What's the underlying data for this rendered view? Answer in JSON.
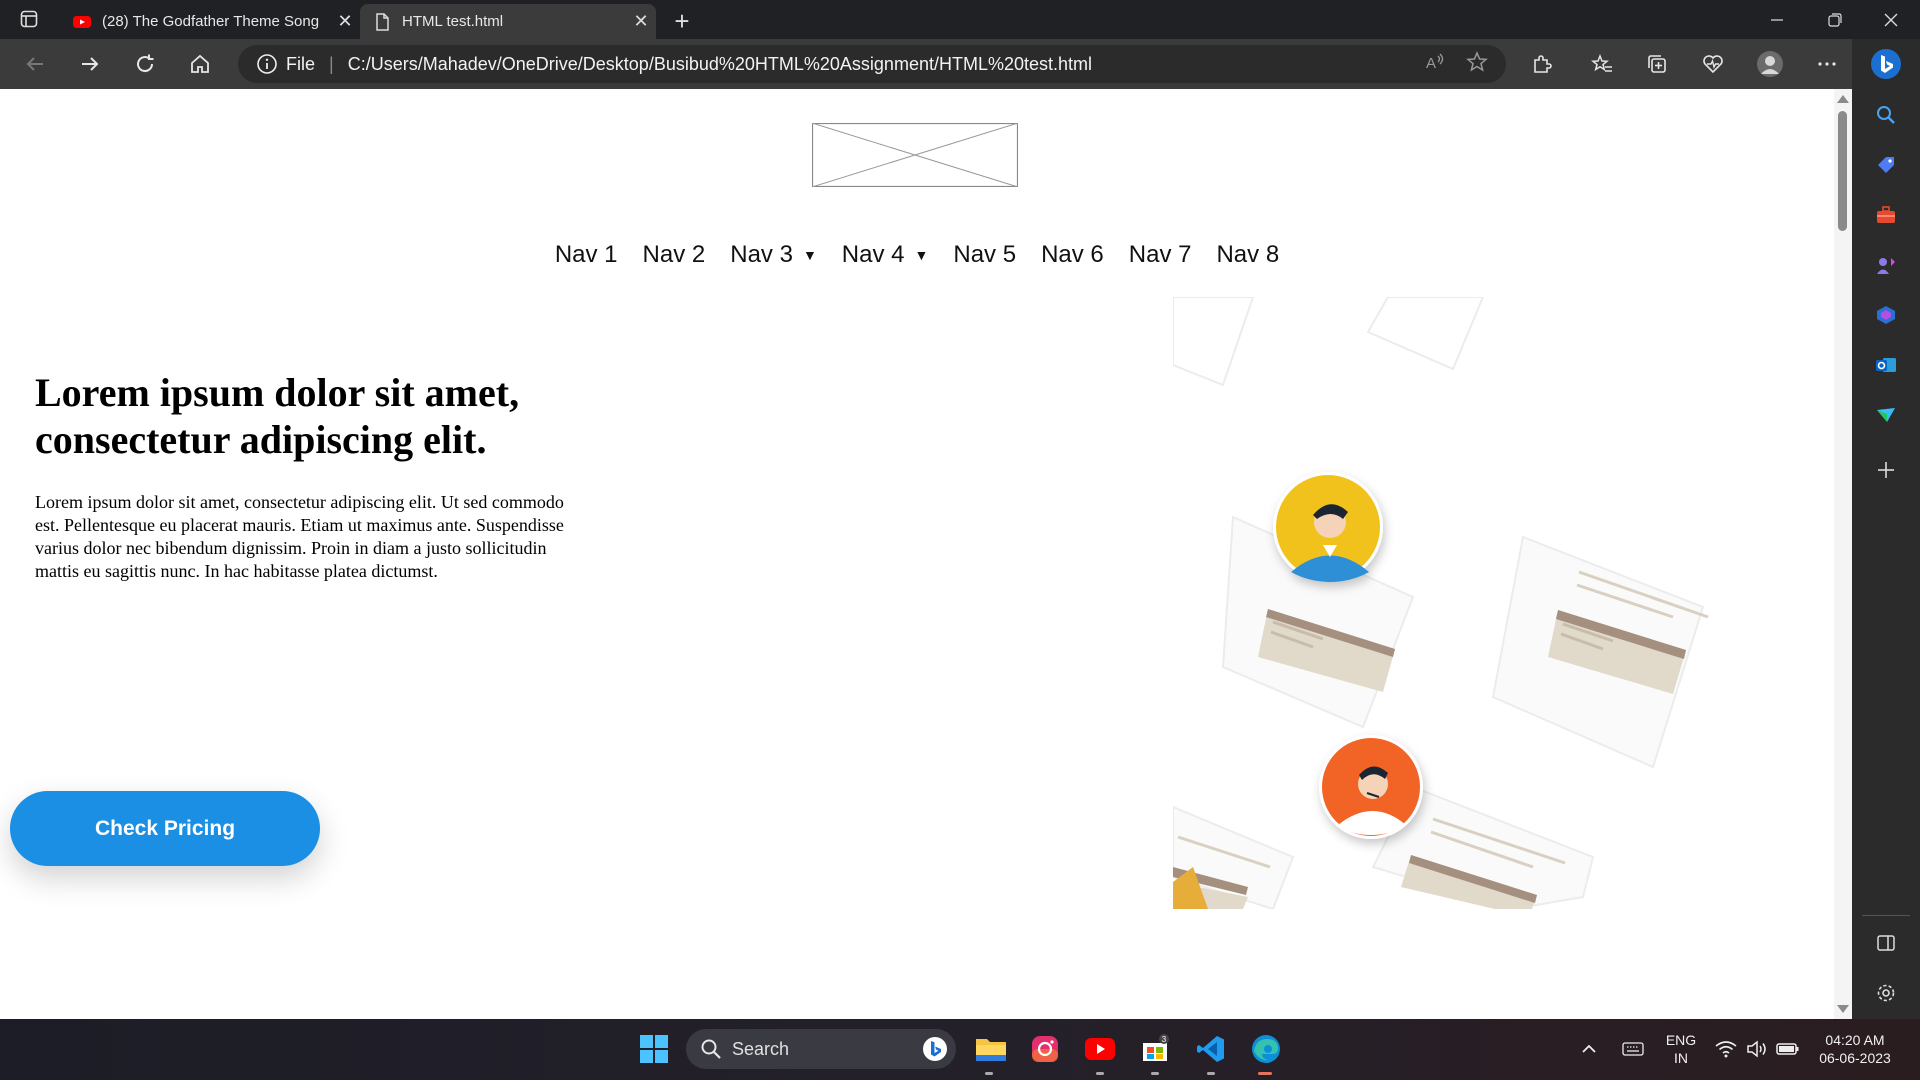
{
  "browser": {
    "tabs": [
      {
        "title": "(28) The Godfather Theme Song",
        "favicon": "youtube-icon",
        "active": false
      },
      {
        "title": "HTML test.html",
        "favicon": "file-icon",
        "active": true
      }
    ],
    "address": {
      "scheme_label": "File",
      "url": "C:/Users/Mahadev/OneDrive/Desktop/Busibud%20HTML%20Assignment/HTML%20test.html"
    },
    "accent_color": "#1a8fe3"
  },
  "page": {
    "nav": [
      {
        "label": "Nav 1",
        "dropdown": false
      },
      {
        "label": "Nav 2",
        "dropdown": false
      },
      {
        "label": "Nav 3",
        "dropdown": true
      },
      {
        "label": "Nav 4",
        "dropdown": true
      },
      {
        "label": "Nav 5",
        "dropdown": false
      },
      {
        "label": "Nav 6",
        "dropdown": false
      },
      {
        "label": "Nav 7",
        "dropdown": false
      },
      {
        "label": "Nav 8",
        "dropdown": false
      }
    ],
    "caret": "▼",
    "hero": {
      "title": "Lorem ipsum dolor sit amet, consectetur adipiscing elit.",
      "text": "Lorem ipsum dolor sit amet, consectetur adipiscing elit. Ut sed commodo est. Pellentesque eu placerat mauris. Etiam ut maximus ante. Suspendisse varius dolor nec bibendum dignissim. Proin in diam a justo sollicitudin mattis eu sagittis nunc. In hac habitasse platea dictumst.",
      "cta_label": "Check Pricing"
    }
  },
  "taskbar": {
    "search_placeholder": "Search",
    "language": "ENG",
    "region": "IN",
    "time": "04:20 AM",
    "date": "06-06-2023",
    "apps": [
      "windows-start-icon",
      "file-explorer-icon",
      "instagram-icon",
      "youtube-icon",
      "microsoft-store-icon",
      "vscode-icon",
      "edge-icon"
    ]
  }
}
